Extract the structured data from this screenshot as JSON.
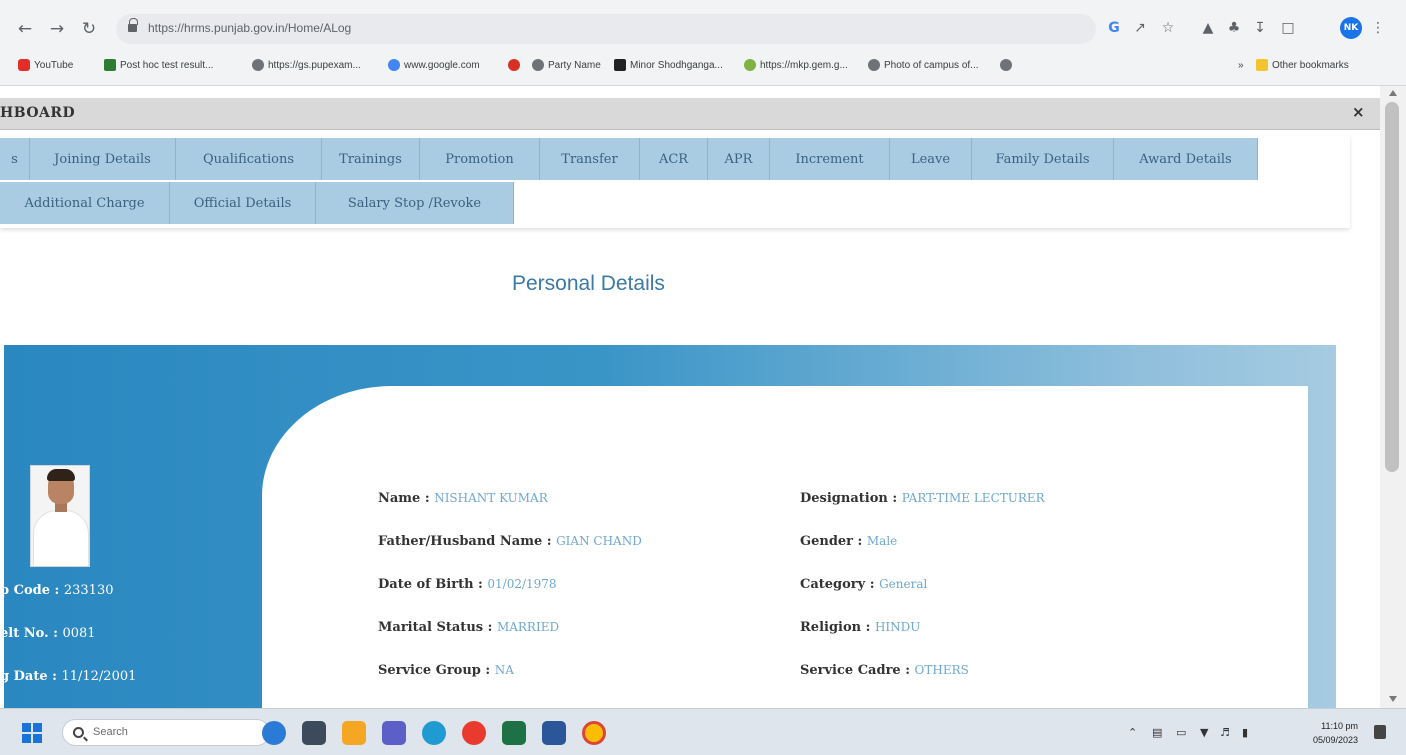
{
  "browser": {
    "url": "https://hrms.punjab.gov.in/Home/ALog",
    "profile_initials": "NK",
    "bookmarks": [
      "YouTube",
      "Post hoc test result...",
      "https://gs.pupexam...",
      "www.google.com",
      "Party Name",
      "Minor Shodhganga...",
      "https://mkp.gem.g...",
      "Photo of campus of...",
      "Other bookmarks"
    ]
  },
  "dashboard": {
    "title": "HBOARD",
    "close_label": "×"
  },
  "tabs": {
    "row1": [
      "s",
      "Joining Details",
      "Qualifications",
      "Trainings",
      "Promotion",
      "Transfer",
      "ACR",
      "APR",
      "Increment",
      "Leave",
      "Family Details",
      "Award Details"
    ],
    "row2": [
      "Additional Charge",
      "Official Details",
      "Salary Stop /Revoke"
    ]
  },
  "section_title": "Personal Details",
  "left_panel": {
    "emp_code_label": "p Code : ",
    "emp_code": "233130",
    "belt_label": "elt No. : ",
    "belt_no": "0081",
    "date_label": "g Date : ",
    "date_value": "11/12/2001"
  },
  "details": {
    "name": {
      "label": "Name : ",
      "value": "NISHANT KUMAR"
    },
    "father": {
      "label": "Father/Husband Name : ",
      "value": "GIAN CHAND"
    },
    "dob": {
      "label": "Date of Birth : ",
      "value": "01/02/1978"
    },
    "marital": {
      "label": "Marital Status : ",
      "value": "MARRIED"
    },
    "service_group": {
      "label": "Service Group : ",
      "value": "NA"
    },
    "designation": {
      "label": "Designation : ",
      "value": "PART-TIME LECTURER"
    },
    "gender": {
      "label": "Gender : ",
      "value": "Male"
    },
    "category": {
      "label": "Category : ",
      "value": "General"
    },
    "religion": {
      "label": "Religion : ",
      "value": "HINDU"
    },
    "service_cadre": {
      "label": "Service Cadre : ",
      "value": "OTHERS"
    }
  },
  "taskbar": {
    "search_placeholder": "Search",
    "time": "11:10 pm",
    "date": "05/09/2023"
  }
}
